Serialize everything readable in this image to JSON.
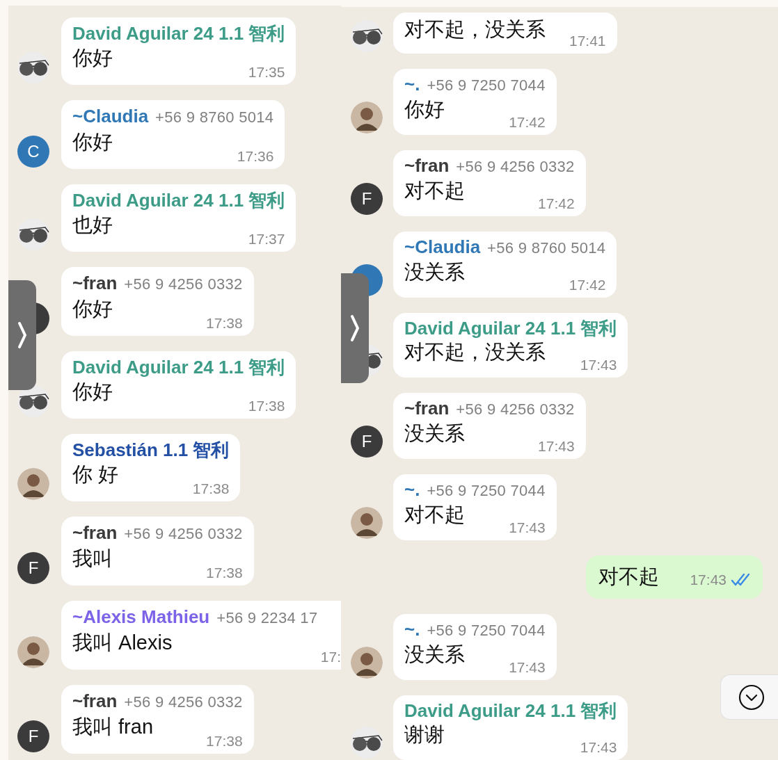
{
  "left_panel": {
    "messages": [
      {
        "kind": "incoming",
        "avatar": {
          "kind": "sunglasses"
        },
        "sender": {
          "name": "David Aguilar 24 1.1 智利",
          "color": "#3d9c87"
        },
        "text": "你好",
        "time": "17:35"
      },
      {
        "kind": "incoming",
        "avatar": {
          "kind": "letter",
          "letter": "C",
          "color": "#2f78b5"
        },
        "sender": {
          "name": "~Claudia",
          "color": "#2f78b5"
        },
        "phone": "+56 9 8760 5014",
        "text": "你好",
        "time": "17:36"
      },
      {
        "kind": "incoming",
        "avatar": {
          "kind": "sunglasses"
        },
        "sender": {
          "name": "David Aguilar 24 1.1 智利",
          "color": "#3d9c87"
        },
        "text": "也好",
        "time": "17:37"
      },
      {
        "kind": "incoming",
        "avatar": {
          "kind": "letter",
          "color": "#3b3b3b"
        },
        "sender": {
          "name": "~fran",
          "color": "#3b3b3b"
        },
        "phone": "+56 9 4256 0332",
        "text": "你好",
        "time": "17:38"
      },
      {
        "kind": "incoming",
        "avatar": {
          "kind": "sunglasses"
        },
        "sender": {
          "name": "David Aguilar 24 1.1 智利",
          "color": "#3d9c87"
        },
        "text": "你好",
        "time": "17:38"
      },
      {
        "kind": "incoming",
        "avatar": {
          "kind": "photo"
        },
        "sender": {
          "name": "Sebastián 1.1 智利",
          "color": "#2350a5"
        },
        "text": "你 好",
        "time": "17:38"
      },
      {
        "kind": "incoming",
        "avatar": {
          "kind": "letter",
          "letter": "F",
          "color": "#3b3b3b"
        },
        "sender": {
          "name": "~fran",
          "color": "#3b3b3b"
        },
        "phone": "+56 9 4256 0332",
        "text": "我叫",
        "time": "17:38"
      },
      {
        "kind": "incoming",
        "cut_off": true,
        "avatar": {
          "kind": "photo"
        },
        "sender": {
          "name": "~Alexis Mathieu",
          "color": "#7d63e8"
        },
        "phone": "+56 9 2234 17",
        "text": "我叫 Alexis",
        "time": "17:"
      },
      {
        "kind": "incoming",
        "avatar": {
          "kind": "letter",
          "letter": "F",
          "color": "#3b3b3b"
        },
        "sender": {
          "name": "~fran",
          "color": "#3b3b3b"
        },
        "phone": "+56 9 4256 0332",
        "text": "我叫 fran",
        "time": "17:38"
      }
    ]
  },
  "right_panel": {
    "messages": [
      {
        "kind": "incoming",
        "avatar": {
          "kind": "sunglasses"
        },
        "text": "对不起，没关系",
        "time": "17:41"
      },
      {
        "kind": "incoming",
        "avatar": {
          "kind": "photo"
        },
        "sender": {
          "name": "~.",
          "color": "#2f78b5"
        },
        "phone": "+56 9 7250 7044",
        "text": "你好",
        "time": "17:42"
      },
      {
        "kind": "incoming",
        "avatar": {
          "kind": "letter",
          "letter": "F",
          "color": "#3b3b3b"
        },
        "sender": {
          "name": "~fran",
          "color": "#3b3b3b"
        },
        "phone": "+56 9 4256 0332",
        "text": "对不起",
        "time": "17:42"
      },
      {
        "kind": "incoming",
        "avatar": {
          "kind": "letter",
          "color": "#2f78b5"
        },
        "sender": {
          "name": "~Claudia",
          "color": "#2f78b5"
        },
        "phone": "+56 9 8760 5014",
        "text": "没关系",
        "time": "17:42"
      },
      {
        "kind": "incoming",
        "avatar": {
          "kind": "sunglasses"
        },
        "sender": {
          "name": "David Aguilar 24 1.1 智利",
          "color": "#3d9c87"
        },
        "text": "对不起，没关系",
        "time": "17:43"
      },
      {
        "kind": "incoming",
        "avatar": {
          "kind": "letter",
          "letter": "F",
          "color": "#3b3b3b"
        },
        "sender": {
          "name": "~fran",
          "color": "#3b3b3b"
        },
        "phone": "+56 9 4256 0332",
        "text": "没关系",
        "time": "17:43"
      },
      {
        "kind": "incoming",
        "avatar": {
          "kind": "photo"
        },
        "sender": {
          "name": "~.",
          "color": "#2f78b5"
        },
        "phone": "+56 9 7250 7044",
        "text": "对不起",
        "time": "17:43"
      },
      {
        "kind": "outgoing",
        "text": "对不起",
        "time": "17:43",
        "read": true
      },
      {
        "kind": "incoming",
        "avatar": {
          "kind": "photo"
        },
        "sender": {
          "name": "~.",
          "color": "#2f78b5"
        },
        "phone": "+56 9 7250 7044",
        "text": "没关系",
        "time": "17:43"
      },
      {
        "kind": "incoming",
        "avatar": {
          "kind": "sunglasses"
        },
        "sender": {
          "name": "David Aguilar 24 1.1 智利",
          "color": "#3d9c87"
        },
        "text": "谢谢",
        "time": "17:43"
      }
    ]
  }
}
